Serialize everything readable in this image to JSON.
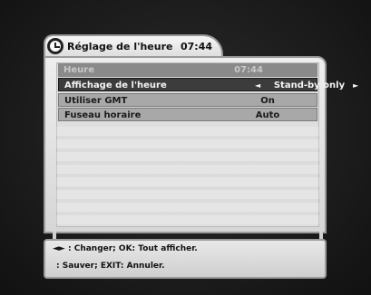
{
  "window": {
    "title": "Réglage de l'heure",
    "time": "07:44"
  },
  "settings": [
    {
      "label": "Heure",
      "value": "07:44",
      "state": "disabled"
    },
    {
      "label": "Affichage de l'heure",
      "value": "Stand-by only",
      "state": "selected"
    },
    {
      "label": "Utiliser GMT",
      "value": "On",
      "state": "normal"
    },
    {
      "label": "Fuseau horaire",
      "value": "Auto",
      "state": "normal"
    }
  ],
  "footer": {
    "line1": "◄► : Changer; OK: Tout afficher.",
    "line2": ": Sauver; EXIT: Annuler."
  },
  "icons": {
    "title": "clock-icon",
    "left_arrow": "left-arrow-icon",
    "right_arrow": "right-arrow-icon"
  },
  "colors": {
    "selected_row": "#3c3c3c",
    "normal_row": "#a8a8a8",
    "disabled_row": "#8a8a8a",
    "panel": "#e6e6e6"
  }
}
